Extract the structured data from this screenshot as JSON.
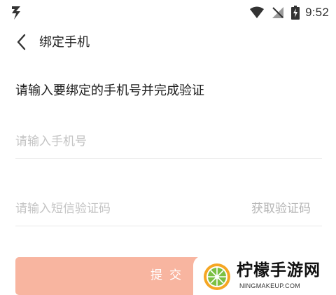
{
  "status_bar": {
    "time": "9:52",
    "icons": [
      "app-notification-icon",
      "wifi-icon",
      "no-signal-icon",
      "battery-charging-icon"
    ]
  },
  "header": {
    "back_icon": "chevron-left-icon",
    "title": "绑定手机"
  },
  "instruction": "请输入要绑定的手机号并完成验证",
  "phone_field": {
    "value": "",
    "placeholder": "请输入手机号"
  },
  "code_field": {
    "value": "",
    "placeholder": "请输入短信验证码",
    "get_code_label": "获取验证码"
  },
  "submit": {
    "label": "提交"
  },
  "watermark": {
    "title": "柠檬手游网",
    "url": "NINGMAKEUP.COM"
  },
  "colors": {
    "accent": "#f8b5a0",
    "placeholder": "#c4c4c4",
    "divider": "#e8e8e8",
    "text": "#222222"
  }
}
